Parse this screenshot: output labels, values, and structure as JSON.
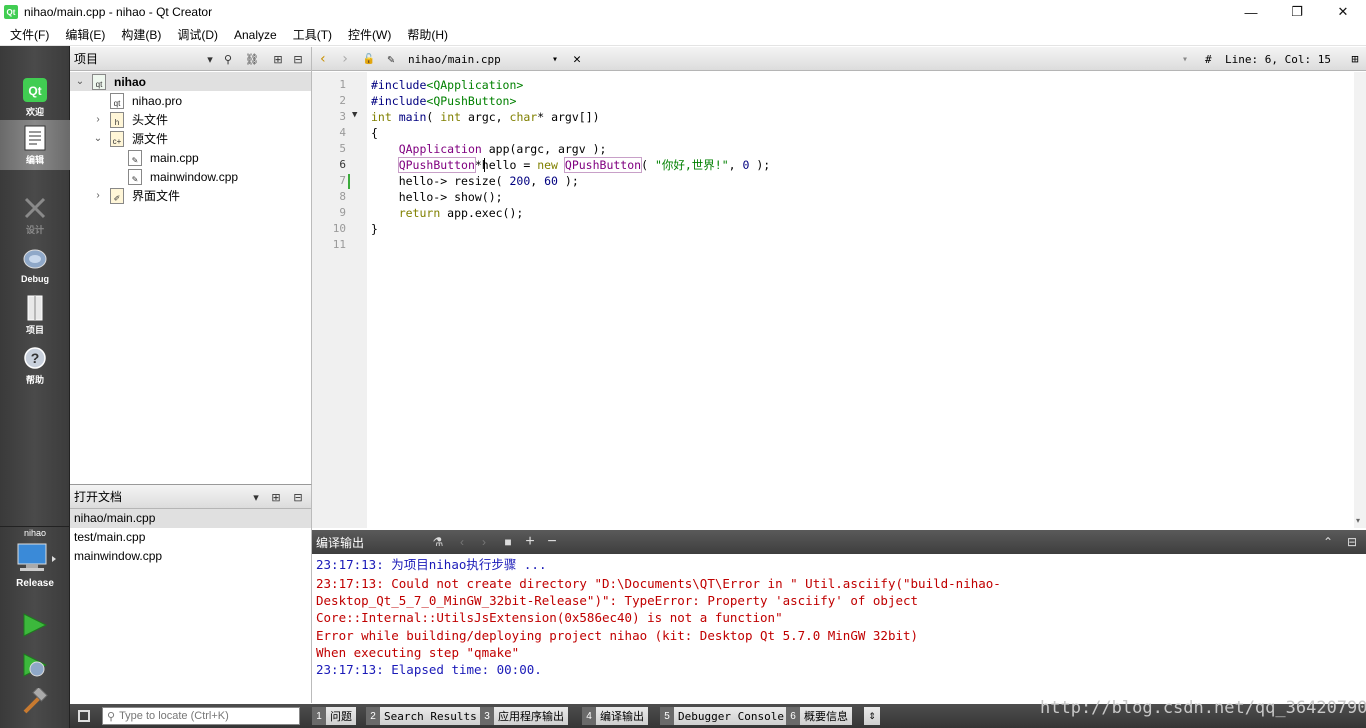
{
  "window": {
    "title": "nihao/main.cpp - nihao - Qt Creator",
    "minimize": "—",
    "maximize": "❐",
    "close": "✕"
  },
  "menubar": [
    "文件(F)",
    "编辑(E)",
    "构建(B)",
    "调试(D)",
    "Analyze",
    "工具(T)",
    "控件(W)",
    "帮助(H)"
  ],
  "modes": {
    "welcome": "欢迎",
    "edit": "编辑",
    "design": "设计",
    "debug": "Debug",
    "projects": "项目",
    "help": "帮助",
    "kit_project": "nihao",
    "kit_build": "Release"
  },
  "project_pane": {
    "title": "项目",
    "tree": [
      {
        "label": "nihao",
        "bold": true
      },
      {
        "label": "nihao.pro"
      },
      {
        "label": "头文件"
      },
      {
        "label": "源文件"
      },
      {
        "label": "main.cpp"
      },
      {
        "label": "mainwindow.cpp"
      },
      {
        "label": "界面文件"
      }
    ]
  },
  "open_docs": {
    "title": "打开文档",
    "items": [
      "nihao/main.cpp",
      "test/main.cpp",
      "mainwindow.cpp"
    ]
  },
  "editor": {
    "file": "nihao/main.cpp",
    "position": "Line: 6, Col: 15",
    "hash": "#",
    "line_numbers": [
      "1",
      "2",
      "3",
      "4",
      "5",
      "6",
      "7",
      "8",
      "9",
      "10",
      "11"
    ],
    "current_line": 6,
    "code": {
      "l1_a": "#include",
      "l1_b": "<QApplication>",
      "l2_a": "#include",
      "l2_b": "<QPushButton>",
      "l3_a": "int",
      "l3_b": " ",
      "l3_c": "main",
      "l3_d": "( ",
      "l3_e": "int",
      "l3_f": " argc, ",
      "l3_g": "char",
      "l3_h": "* argv[])",
      "l4": "{",
      "l5_a": "    ",
      "l5_b": "QApplication",
      "l5_c": " app(argc, argv );",
      "l6_a": "    ",
      "l6_b": "QPushButton",
      "l6_c": "*hello = ",
      "l6_d": "new",
      "l6_e": " ",
      "l6_f": "QPushButton",
      "l6_g": "( ",
      "l6_h": "\"你好,世界!\"",
      "l6_i": ", ",
      "l6_j": "0",
      "l6_k": " );",
      "l7_a": "    hello-> resize( ",
      "l7_b": "200",
      "l7_c": ", ",
      "l7_d": "60",
      "l7_e": " );",
      "l8": "    hello-> show();",
      "l9_a": "    ",
      "l9_b": "return",
      "l9_c": " app.exec();",
      "l10": "}"
    }
  },
  "output_pane": {
    "title": "编译输出",
    "lines": [
      {
        "text": "23:17:13: 为项目nihao执行步骤 ...",
        "color": "#1a1ab8"
      },
      {
        "text": "23:17:13: Could not create directory \"D:\\Documents\\QT\\Error in \" Util.asciify(\"build-nihao-",
        "color": "#c00000"
      },
      {
        "text": "Desktop_Qt_5_7_0_MinGW_32bit-Release\")\": TypeError: Property 'asciify' of object",
        "color": "#c00000"
      },
      {
        "text": "Core::Internal::UtilsJsExtension(0x586ec40) is not a function\"",
        "color": "#c00000"
      },
      {
        "text": "Error while building/deploying project nihao (kit: Desktop Qt 5.7.0 MinGW 32bit)",
        "color": "#c00000"
      },
      {
        "text": "When executing step \"qmake\"",
        "color": "#c00000"
      },
      {
        "text": "23:17:13: Elapsed time: 00:00.",
        "color": "#1a1ab8"
      }
    ]
  },
  "statusbar": {
    "locate_placeholder": "Type to locate (Ctrl+K)",
    "tabs": [
      {
        "num": "1",
        "label": "问题"
      },
      {
        "num": "2",
        "label": "Search Results"
      },
      {
        "num": "3",
        "label": "应用程序输出"
      },
      {
        "num": "4",
        "label": "编译输出"
      },
      {
        "num": "5",
        "label": "Debugger Console"
      },
      {
        "num": "6",
        "label": "概要信息"
      }
    ]
  },
  "watermark": "http://blog.csdn.net/qq_36420790"
}
